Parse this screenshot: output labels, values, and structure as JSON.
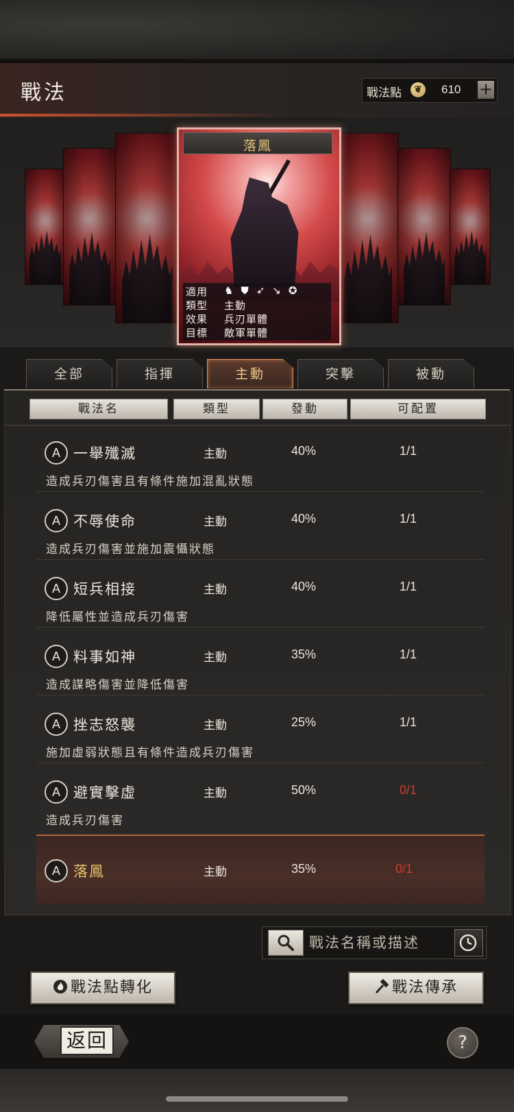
{
  "header": {
    "title": "戰法",
    "points_label": "戰法點",
    "points_value": "610",
    "points_plus": "+"
  },
  "featured_card": {
    "title": "落鳳",
    "info": [
      {
        "key": "適用",
        "value": ""
      },
      {
        "key": "類型",
        "value": "主動"
      },
      {
        "key": "效果",
        "value": "兵刃單體"
      },
      {
        "key": "目標",
        "value": "敵軍單體"
      }
    ],
    "troop_icons": [
      "cavalry-icon",
      "shield-icon",
      "bow-icon",
      "spear-icon",
      "wheel-icon"
    ]
  },
  "tabs": [
    {
      "label": "全部",
      "active": false
    },
    {
      "label": "指揮",
      "active": false
    },
    {
      "label": "主動",
      "active": true
    },
    {
      "label": "突擊",
      "active": false
    },
    {
      "label": "被動",
      "active": false
    }
  ],
  "columns": [
    "戰法名",
    "類型",
    "發動",
    "可配置"
  ],
  "tactics": [
    {
      "badge": "A",
      "name": "一舉殲滅",
      "type": "主動",
      "rate": "40%",
      "slots": "1/1",
      "desc": "造成兵刃傷害且有條件施加混亂狀態"
    },
    {
      "badge": "A",
      "name": "不辱使命",
      "type": "主動",
      "rate": "40%",
      "slots": "1/1",
      "desc": "造成兵刃傷害並施加震懾狀態"
    },
    {
      "badge": "A",
      "name": "短兵相接",
      "type": "主動",
      "rate": "40%",
      "slots": "1/1",
      "desc": "降低屬性並造成兵刃傷害"
    },
    {
      "badge": "A",
      "name": "料事如神",
      "type": "主動",
      "rate": "35%",
      "slots": "1/1",
      "desc": "造成謀略傷害並降低傷害"
    },
    {
      "badge": "A",
      "name": "挫志怒襲",
      "type": "主動",
      "rate": "25%",
      "slots": "1/1",
      "desc": "施加虛弱狀態且有條件造成兵刃傷害"
    },
    {
      "badge": "A",
      "name": "避實擊虛",
      "type": "主動",
      "rate": "50%",
      "slots": "0/1",
      "desc": "造成兵刃傷害"
    }
  ],
  "selected_tactic": {
    "badge": "A",
    "name": "落鳳",
    "type": "主動",
    "rate": "35%",
    "slots": "0/1"
  },
  "search": {
    "placeholder": "戰法名稱或描述"
  },
  "buttons": {
    "convert": "戰法點轉化",
    "inherit": "戰法傳承",
    "back": "返回",
    "help": "?"
  },
  "colors": {
    "accent_gold": "#e7c66e",
    "slot_red": "#d23a2e",
    "active_tab_border": "#e08c5c"
  }
}
